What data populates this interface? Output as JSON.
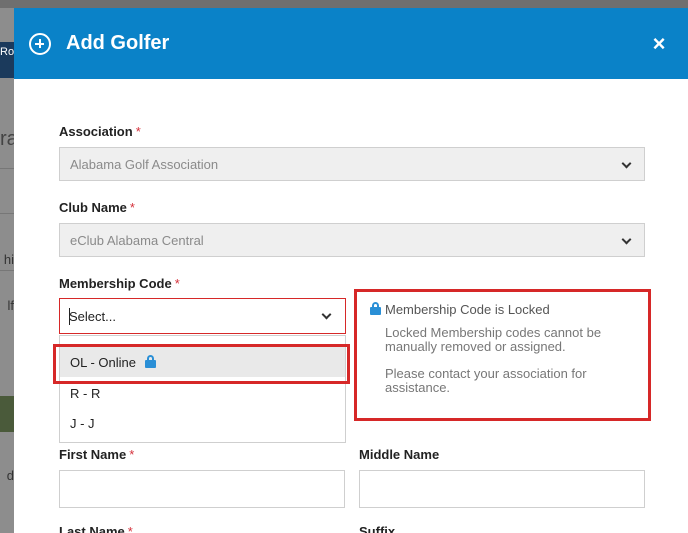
{
  "backdrop": {
    "fragments": [
      "Ro",
      "ra",
      "hi",
      "lf",
      "d"
    ]
  },
  "modal": {
    "title": "Add Golfer",
    "close_label": "×"
  },
  "form": {
    "association": {
      "label": "Association",
      "required": "*",
      "value": "Alabama Golf Association"
    },
    "club_name": {
      "label": "Club Name",
      "required": "*",
      "value": "eClub Alabama Central"
    },
    "membership_code": {
      "label": "Membership Code",
      "required": "*",
      "value": "Select...",
      "options": [
        {
          "label": "OL - Online",
          "locked": true
        },
        {
          "label": "R - R",
          "locked": false
        },
        {
          "label": "J - J",
          "locked": false
        }
      ]
    },
    "first_name": {
      "label": "First Name",
      "required": "*"
    },
    "middle_name": {
      "label": "Middle Name"
    },
    "last_name": {
      "label": "Last Name",
      "required": "*"
    },
    "suffix": {
      "label": "Suffix"
    }
  },
  "locked_info": {
    "title": "Membership Code is Locked",
    "line1": "Locked Membership codes cannot be manually removed or assigned.",
    "line2": "Please contact your association for assistance."
  },
  "colors": {
    "header": "#0a82c8",
    "highlight": "#d62828",
    "lock": "#2a8fd6",
    "required": "#d4303a"
  }
}
